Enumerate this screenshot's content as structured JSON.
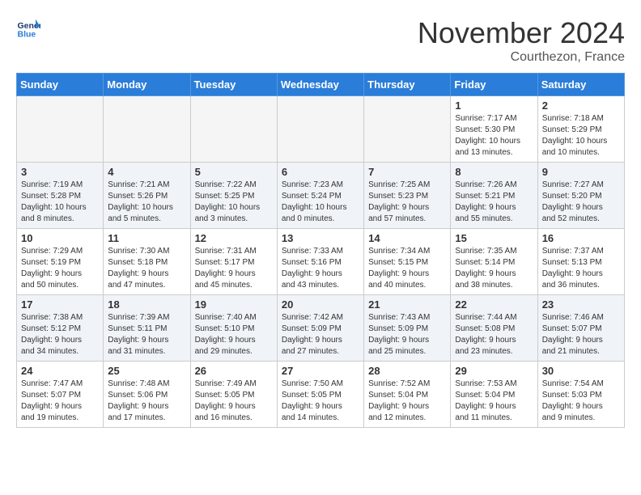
{
  "logo": {
    "line1": "General",
    "line2": "Blue"
  },
  "title": "November 2024",
  "location": "Courthezon, France",
  "days_of_week": [
    "Sunday",
    "Monday",
    "Tuesday",
    "Wednesday",
    "Thursday",
    "Friday",
    "Saturday"
  ],
  "weeks": [
    [
      {
        "day": "",
        "info": ""
      },
      {
        "day": "",
        "info": ""
      },
      {
        "day": "",
        "info": ""
      },
      {
        "day": "",
        "info": ""
      },
      {
        "day": "",
        "info": ""
      },
      {
        "day": "1",
        "info": "Sunrise: 7:17 AM\nSunset: 5:30 PM\nDaylight: 10 hours\nand 13 minutes."
      },
      {
        "day": "2",
        "info": "Sunrise: 7:18 AM\nSunset: 5:29 PM\nDaylight: 10 hours\nand 10 minutes."
      }
    ],
    [
      {
        "day": "3",
        "info": "Sunrise: 7:19 AM\nSunset: 5:28 PM\nDaylight: 10 hours\nand 8 minutes."
      },
      {
        "day": "4",
        "info": "Sunrise: 7:21 AM\nSunset: 5:26 PM\nDaylight: 10 hours\nand 5 minutes."
      },
      {
        "day": "5",
        "info": "Sunrise: 7:22 AM\nSunset: 5:25 PM\nDaylight: 10 hours\nand 3 minutes."
      },
      {
        "day": "6",
        "info": "Sunrise: 7:23 AM\nSunset: 5:24 PM\nDaylight: 10 hours\nand 0 minutes."
      },
      {
        "day": "7",
        "info": "Sunrise: 7:25 AM\nSunset: 5:23 PM\nDaylight: 9 hours\nand 57 minutes."
      },
      {
        "day": "8",
        "info": "Sunrise: 7:26 AM\nSunset: 5:21 PM\nDaylight: 9 hours\nand 55 minutes."
      },
      {
        "day": "9",
        "info": "Sunrise: 7:27 AM\nSunset: 5:20 PM\nDaylight: 9 hours\nand 52 minutes."
      }
    ],
    [
      {
        "day": "10",
        "info": "Sunrise: 7:29 AM\nSunset: 5:19 PM\nDaylight: 9 hours\nand 50 minutes."
      },
      {
        "day": "11",
        "info": "Sunrise: 7:30 AM\nSunset: 5:18 PM\nDaylight: 9 hours\nand 47 minutes."
      },
      {
        "day": "12",
        "info": "Sunrise: 7:31 AM\nSunset: 5:17 PM\nDaylight: 9 hours\nand 45 minutes."
      },
      {
        "day": "13",
        "info": "Sunrise: 7:33 AM\nSunset: 5:16 PM\nDaylight: 9 hours\nand 43 minutes."
      },
      {
        "day": "14",
        "info": "Sunrise: 7:34 AM\nSunset: 5:15 PM\nDaylight: 9 hours\nand 40 minutes."
      },
      {
        "day": "15",
        "info": "Sunrise: 7:35 AM\nSunset: 5:14 PM\nDaylight: 9 hours\nand 38 minutes."
      },
      {
        "day": "16",
        "info": "Sunrise: 7:37 AM\nSunset: 5:13 PM\nDaylight: 9 hours\nand 36 minutes."
      }
    ],
    [
      {
        "day": "17",
        "info": "Sunrise: 7:38 AM\nSunset: 5:12 PM\nDaylight: 9 hours\nand 34 minutes."
      },
      {
        "day": "18",
        "info": "Sunrise: 7:39 AM\nSunset: 5:11 PM\nDaylight: 9 hours\nand 31 minutes."
      },
      {
        "day": "19",
        "info": "Sunrise: 7:40 AM\nSunset: 5:10 PM\nDaylight: 9 hours\nand 29 minutes."
      },
      {
        "day": "20",
        "info": "Sunrise: 7:42 AM\nSunset: 5:09 PM\nDaylight: 9 hours\nand 27 minutes."
      },
      {
        "day": "21",
        "info": "Sunrise: 7:43 AM\nSunset: 5:09 PM\nDaylight: 9 hours\nand 25 minutes."
      },
      {
        "day": "22",
        "info": "Sunrise: 7:44 AM\nSunset: 5:08 PM\nDaylight: 9 hours\nand 23 minutes."
      },
      {
        "day": "23",
        "info": "Sunrise: 7:46 AM\nSunset: 5:07 PM\nDaylight: 9 hours\nand 21 minutes."
      }
    ],
    [
      {
        "day": "24",
        "info": "Sunrise: 7:47 AM\nSunset: 5:07 PM\nDaylight: 9 hours\nand 19 minutes."
      },
      {
        "day": "25",
        "info": "Sunrise: 7:48 AM\nSunset: 5:06 PM\nDaylight: 9 hours\nand 17 minutes."
      },
      {
        "day": "26",
        "info": "Sunrise: 7:49 AM\nSunset: 5:05 PM\nDaylight: 9 hours\nand 16 minutes."
      },
      {
        "day": "27",
        "info": "Sunrise: 7:50 AM\nSunset: 5:05 PM\nDaylight: 9 hours\nand 14 minutes."
      },
      {
        "day": "28",
        "info": "Sunrise: 7:52 AM\nSunset: 5:04 PM\nDaylight: 9 hours\nand 12 minutes."
      },
      {
        "day": "29",
        "info": "Sunrise: 7:53 AM\nSunset: 5:04 PM\nDaylight: 9 hours\nand 11 minutes."
      },
      {
        "day": "30",
        "info": "Sunrise: 7:54 AM\nSunset: 5:03 PM\nDaylight: 9 hours\nand 9 minutes."
      }
    ]
  ]
}
